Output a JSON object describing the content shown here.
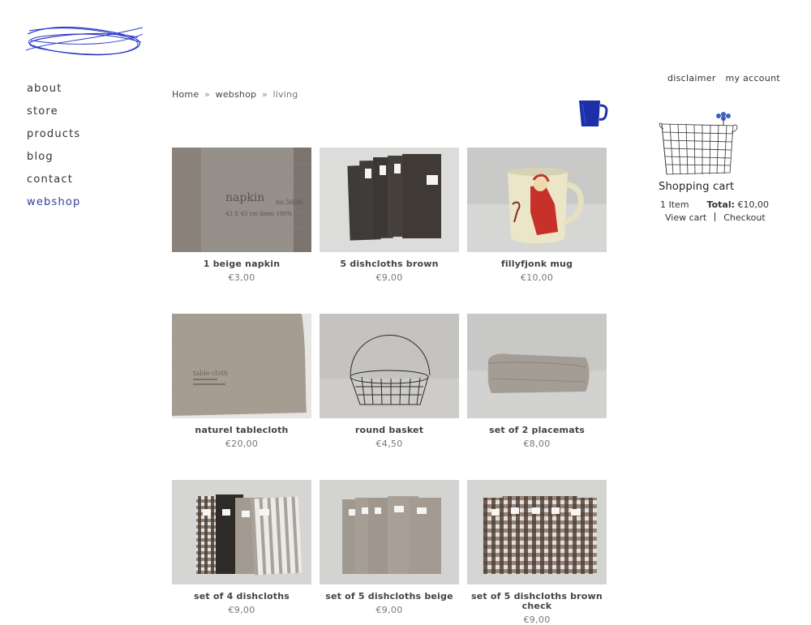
{
  "nav": {
    "items": [
      {
        "label": "about"
      },
      {
        "label": "store"
      },
      {
        "label": "products"
      },
      {
        "label": "blog"
      },
      {
        "label": "contact"
      },
      {
        "label": "webshop",
        "active": true
      }
    ]
  },
  "top_links": {
    "disclaimer": "disclaimer",
    "account": "my account"
  },
  "breadcrumb": {
    "home": "Home",
    "sep": "»",
    "webshop": "webshop",
    "current": "living"
  },
  "icons": {
    "logo": "scribble-logo",
    "mug": "mug-icon",
    "basket": "wire-basket-icon"
  },
  "cart": {
    "title": "Shopping cart",
    "items": "1 Item",
    "total_label": "Total:",
    "total_value": "€10,00",
    "view_cart": "View cart",
    "checkout": "Checkout"
  },
  "products": [
    {
      "name": "1 beige napkin",
      "price": "€3,00"
    },
    {
      "name": "5 dishcloths brown",
      "price": "€9,00"
    },
    {
      "name": "fillyfjonk mug",
      "price": "€10,00"
    },
    {
      "name": "naturel tablecloth",
      "price": "€20,00"
    },
    {
      "name": "round basket",
      "price": "€4,50"
    },
    {
      "name": "set of 2 placemats",
      "price": "€8,00"
    },
    {
      "name": "set of 4 dishcloths",
      "price": "€9,00"
    },
    {
      "name": "set of 5 dishcloths beige",
      "price": "€9,00"
    },
    {
      "name": "set of 5 dishcloths brown check",
      "price": "€9,00"
    }
  ],
  "image_text": {
    "napkin_tag": "napkin",
    "napkin_no": "no.5026",
    "napkin_size": "43 X 43 cm  linen 100%",
    "tablecloth_tag": "table cloth"
  },
  "colors": {
    "accent": "#2d3fa0",
    "logo": "#2a38c8"
  }
}
